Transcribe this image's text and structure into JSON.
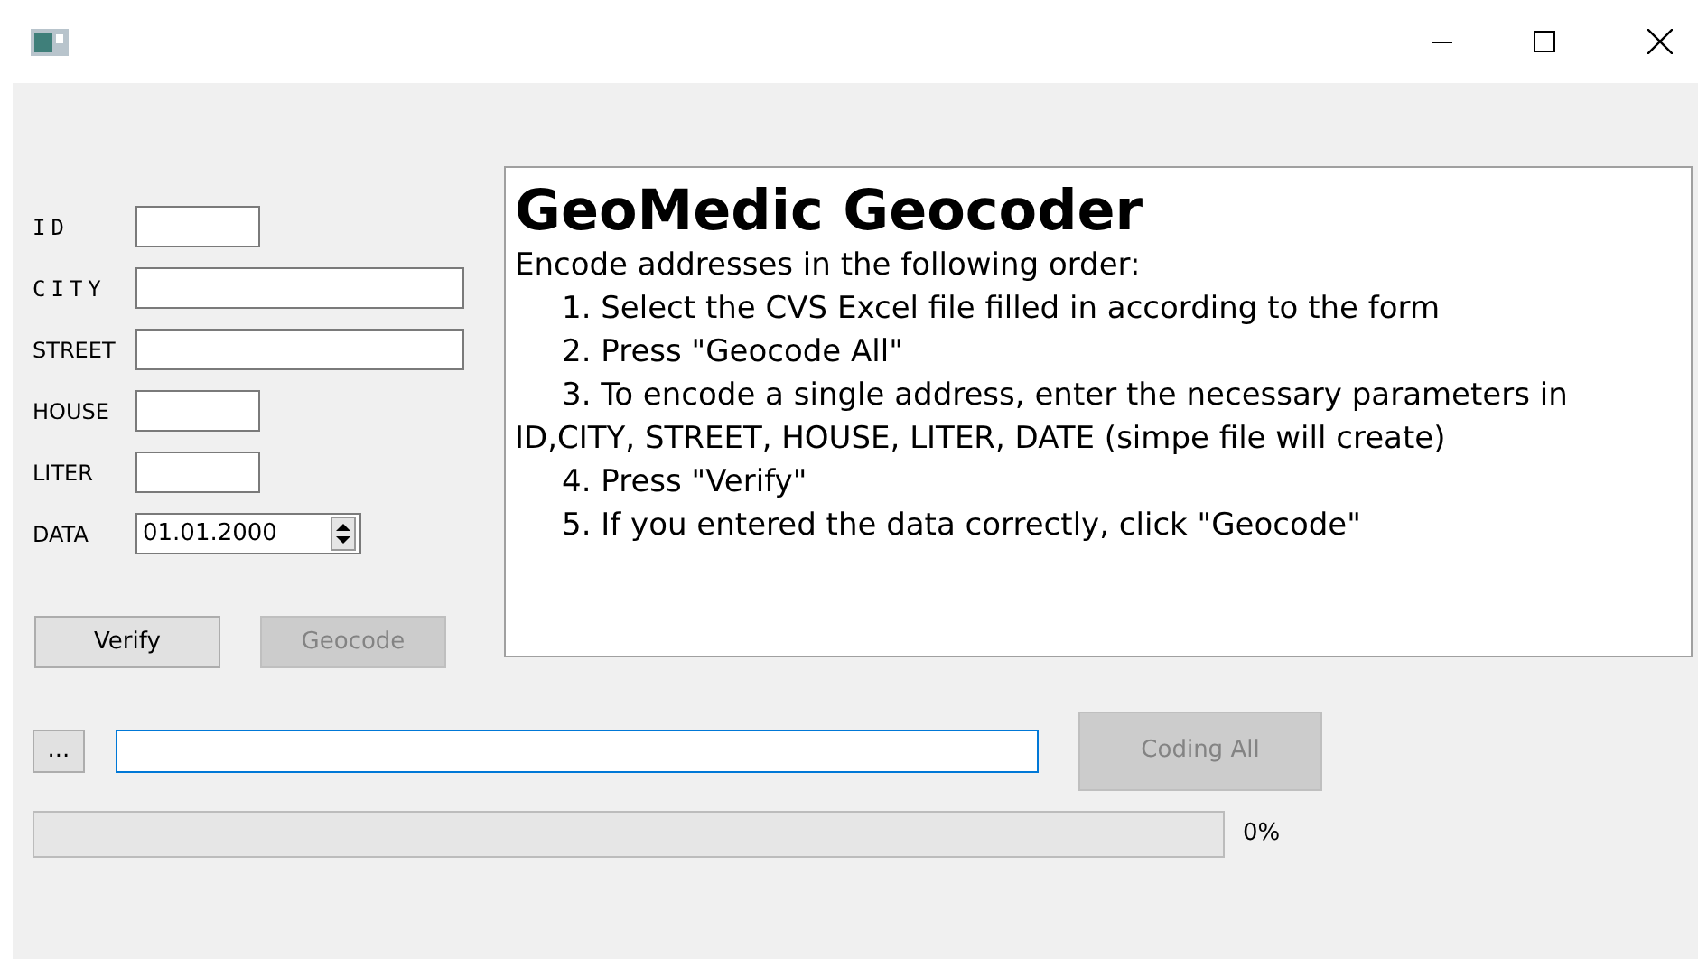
{
  "form": {
    "fields": [
      {
        "label": "ID",
        "kind": "text",
        "spaced": true
      },
      {
        "label": "CITY",
        "kind": "text",
        "spaced": true
      },
      {
        "label": "STREET",
        "kind": "text",
        "spaced": false
      },
      {
        "label": "HOUSE",
        "kind": "text",
        "spaced": false
      },
      {
        "label": "LITER",
        "kind": "text",
        "spaced": false
      },
      {
        "label": "DATA",
        "kind": "date",
        "spaced": false,
        "value": "01.01.2000"
      }
    ],
    "buttons": [
      {
        "label": "Verify",
        "disabled": false
      },
      {
        "label": "Geocode",
        "disabled": true
      }
    ]
  },
  "info": {
    "title": "GeoMedic Geocoder",
    "intro": "Encode addresses in the following order:",
    "steps": [
      "1. Select the CVS Excel file filled in according to the form",
      "2. Press \"Geocode All\"",
      "3. To encode a single address, enter the necessary parameters in ID,CITY, STREET, HOUSE, LITER, DATE (simpe file will create)",
      "4. Press \"Verify\"",
      "5. If you entered the data correctly, click \"Geocode\""
    ]
  },
  "file_row": {
    "browse": {
      "label": "...",
      "disabled": false
    },
    "path": {
      "focused": true
    },
    "coding_all": {
      "label": "Coding All",
      "disabled": true
    }
  },
  "progress": {
    "level": 0,
    "reading": "0%"
  }
}
